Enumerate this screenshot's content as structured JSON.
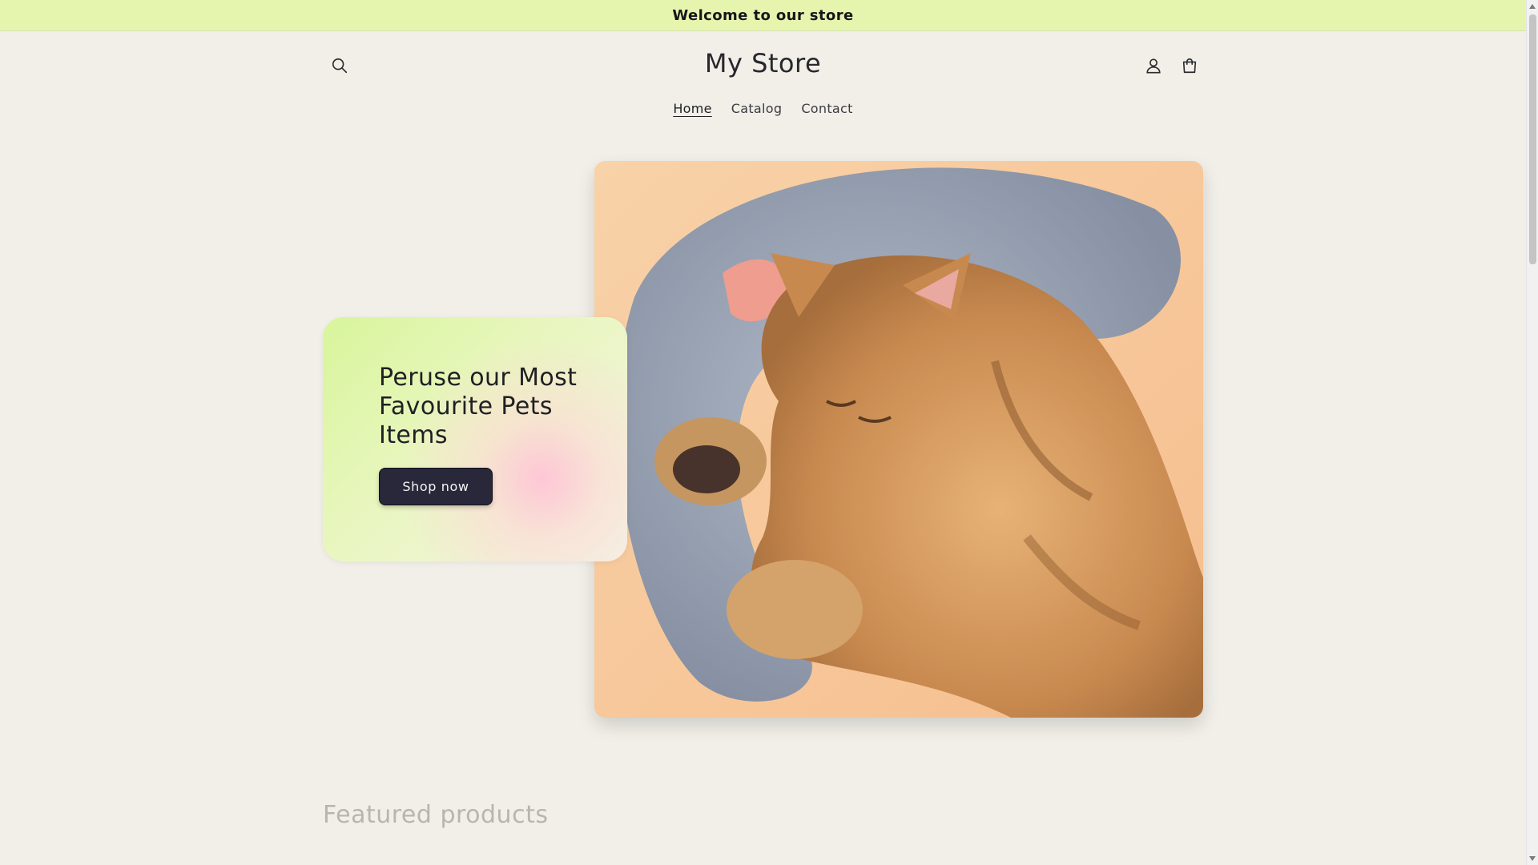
{
  "announcement": {
    "text": "Welcome to our store"
  },
  "header": {
    "store_name": "My Store",
    "icons": {
      "search": "search-icon",
      "account": "user-icon",
      "cart": "cart-icon"
    }
  },
  "nav": {
    "items": [
      {
        "label": "Home",
        "active": true
      },
      {
        "label": "Catalog",
        "active": false
      },
      {
        "label": "Contact",
        "active": false
      }
    ]
  },
  "hero": {
    "heading": "Peruse our Most Favourite Pets Items",
    "button_label": "Shop now",
    "image_subject": "kitten-sleeping-on-pillow"
  },
  "featured": {
    "title": "Featured products"
  },
  "colors": {
    "page_background": "#f1efe8",
    "announcement_background": "#e6f5ae",
    "button_background": "#28283a",
    "text_primary": "#1f1f24"
  }
}
